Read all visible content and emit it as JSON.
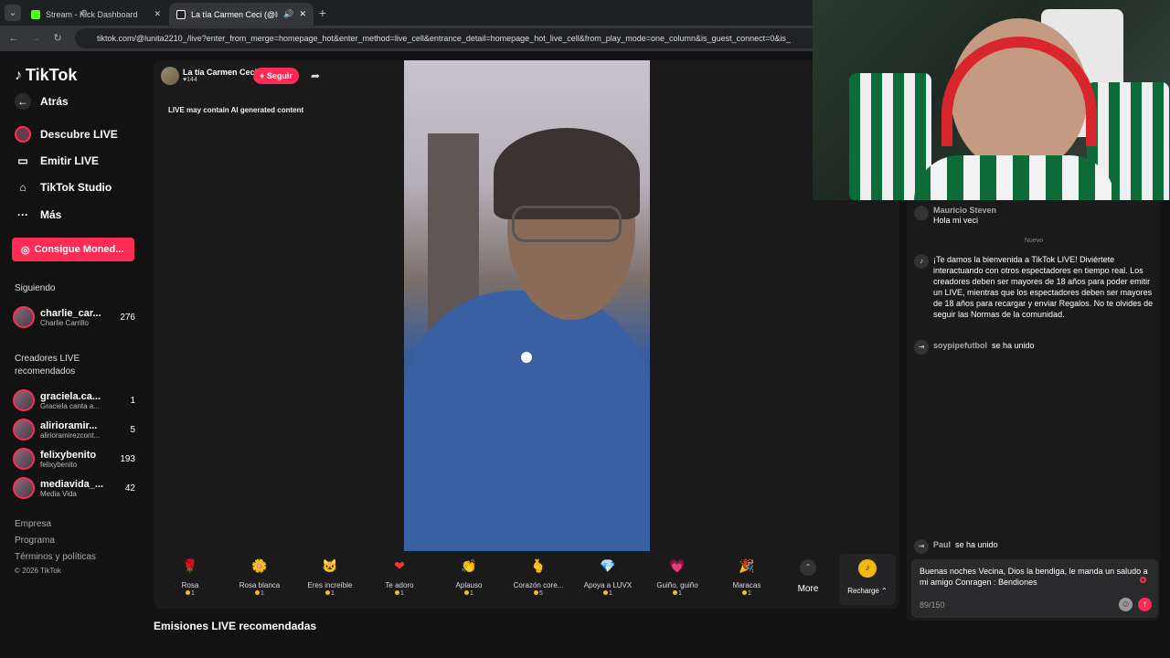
{
  "browser": {
    "tabs": [
      {
        "label": "Stream - Kick Dashboard",
        "icon": "kick-icon"
      },
      {
        "label": "La tía Carmen Ceci (@lunita",
        "icon": "tiktok-icon"
      }
    ],
    "url": "tiktok.com/@lunita2210_/live?enter_from_merge=homepage_hot&enter_method=live_cell&entrance_detail=homepage_hot_live_cell&from_play_mode=one_column&is_guest_connect=0&is_"
  },
  "sidebar": {
    "logo": "TikTok",
    "back": "Atrás",
    "nav": [
      "Descubre LIVE",
      "Emitir LIVE",
      "TikTok Studio",
      "Más"
    ],
    "coins_button": "Consigue Moned...",
    "following_title": "Siguiendo",
    "following": [
      {
        "name": "charlie_car...",
        "sub": "Charlie Carrillo",
        "count": "276"
      }
    ],
    "recommended_title_1": "Creadores LIVE",
    "recommended_title_2": "recomendados",
    "recommended": [
      {
        "name": "graciela.ca...",
        "sub": "Graciela canta a...",
        "count": "1"
      },
      {
        "name": "alirioramir...",
        "sub": "alirioramirezcont...",
        "count": "5"
      },
      {
        "name": "felixybenito",
        "sub": "felixybenito",
        "count": "193"
      },
      {
        "name": "mediavida_...",
        "sub": "Media Vida",
        "count": "42"
      }
    ],
    "footer": [
      "Empresa",
      "Programa",
      "Términos y políticas",
      "© 2026 TikTok"
    ]
  },
  "player": {
    "host_name": "La tía Carmen Ceci",
    "host_likes": "♥144",
    "follow": "+ Seguir",
    "ai_notice": "LIVE may contain AI generated content",
    "recommended_title": "Emisiones LIVE recomendadas"
  },
  "gifts": [
    {
      "name": "Rosa",
      "price": "1",
      "icon": "🌹"
    },
    {
      "name": "Rosa blanca",
      "price": "1",
      "icon": "🌼"
    },
    {
      "name": "Eres increíble",
      "price": "1",
      "icon": "🐱"
    },
    {
      "name": "Te adoro",
      "price": "1",
      "icon": "❤"
    },
    {
      "name": "Aplauso",
      "price": "1",
      "icon": "👏"
    },
    {
      "name": "Corazón core...",
      "price": "5",
      "icon": "🫰"
    },
    {
      "name": "Apoya a LUVX",
      "price": "1",
      "icon": "💎"
    },
    {
      "name": "Guiño, guiño",
      "price": "1",
      "icon": "💗"
    },
    {
      "name": "Maracas",
      "price": "1",
      "icon": "🎉"
    }
  ],
  "more_label": "More",
  "recharge_label": "Recharge ⌃",
  "chat": {
    "messages": [
      {
        "user": "Mauricio Steven",
        "text": "Hola mi veci"
      },
      {
        "user": "",
        "text": "¡Te damos la bienvenida a TikTok LIVE! Diviértete interactuando con otros espectadores en tiempo real. Los creadores deben ser mayores de 18 años para poder emitir un LIVE, mientras que los espectadores deben ser mayores de 18 años para recargar y enviar Regalos. No te olvides de seguir las Normas de la comunidad."
      },
      {
        "user": "soypipefutbol",
        "text": "se ha unido"
      },
      {
        "user": "Paul",
        "text": "se ha unido"
      }
    ],
    "divider": "Nuevo",
    "input_text": "Buenas noches Vecina, Dios la bendiga, le manda un saludo a mi amigo Conragen : Bendiones",
    "counter": "89/150"
  },
  "colors": {
    "accent": "#fe2c55",
    "background": "#121212"
  }
}
